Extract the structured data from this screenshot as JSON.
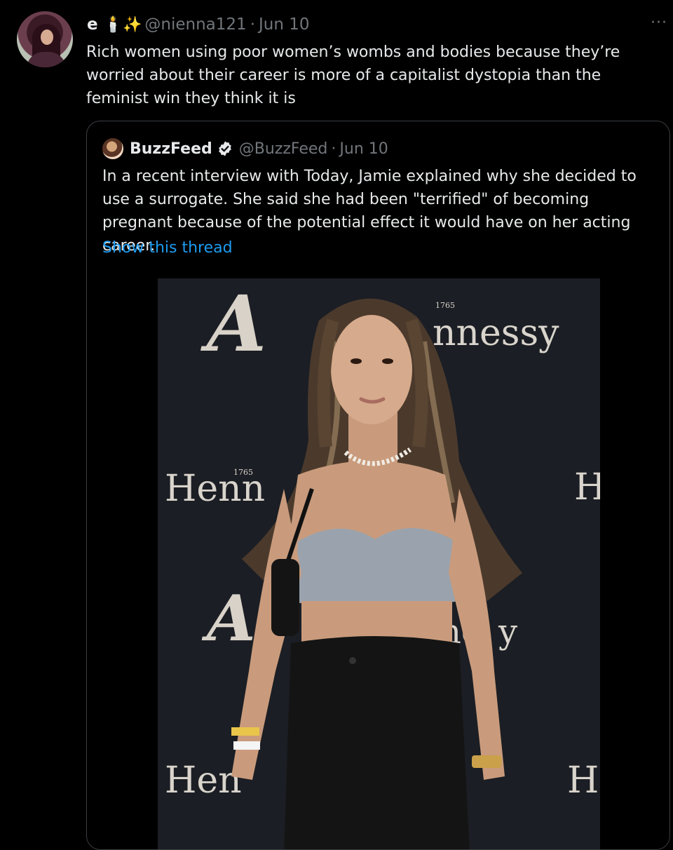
{
  "tweet": {
    "author_name": "e",
    "author_emojis": "🕯️✨",
    "handle": "@nienna121",
    "separator": "·",
    "date": "Jun 10",
    "more_label": "···",
    "text": "Rich women using poor women’s wombs and bodies because they’re worried about their career is more of a capitalist dystopia than the feminist win they think it is"
  },
  "quoted": {
    "author_name": "BuzzFeed",
    "verified": true,
    "handle": "@BuzzFeed",
    "separator": "·",
    "date": "Jun 10",
    "text": "In a recent interview with Today, Jamie explained why she decided to use a surrogate. She said she had been \"terrified\" of becoming pregnant because of the potential effect it would have on her acting career.",
    "show_thread": "Show this thread"
  },
  "photo": {
    "backdrop_texts": [
      "nnessy",
      "Henn",
      "H",
      "ne",
      "y",
      "Hen",
      "H"
    ],
    "backdrop_year": "1765"
  },
  "colors": {
    "background": "#000000",
    "text": "#e7e9ea",
    "muted": "#71767b",
    "link": "#1d9bf0",
    "verified": "#e7e9ea"
  }
}
